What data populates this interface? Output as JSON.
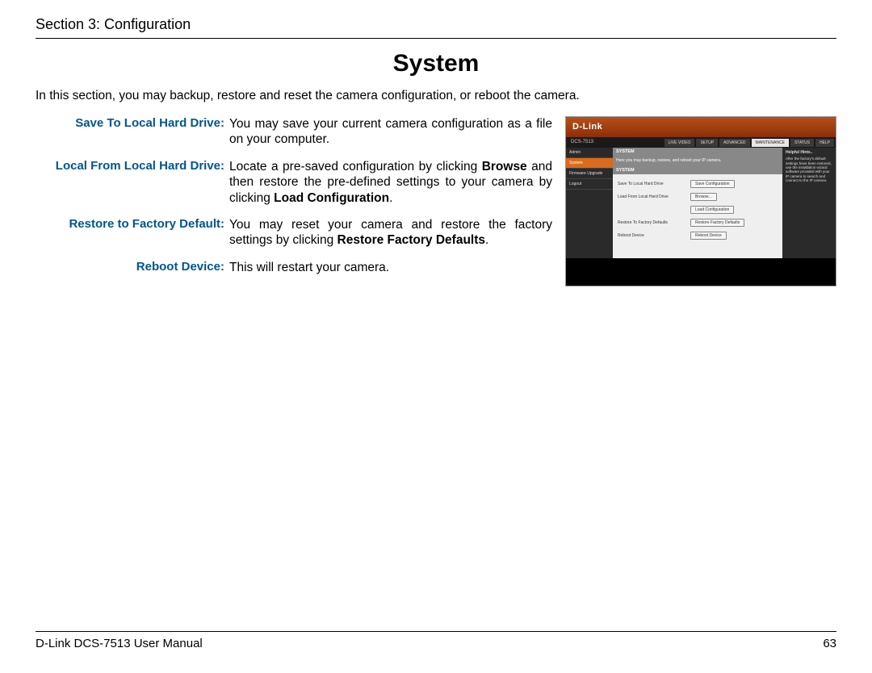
{
  "header": {
    "section": "Section 3: Configuration"
  },
  "title": "System",
  "intro": "In this section, you may backup, restore and reset the camera configuration, or reboot the camera.",
  "definitions": [
    {
      "label": "Save To Local Hard Drive:",
      "desc": "You may save your current camera configuration as a file on your computer."
    },
    {
      "label": "Local From Local Hard Drive:",
      "desc": "Locate a pre-saved configuration by clicking <b>Browse</b> and then restore the pre-defined settings to your camera by clicking <b>Load Configuration</b>."
    },
    {
      "label": "Restore to Factory Default:",
      "desc": "You may reset your camera and restore the factory settings by clicking <b>Restore Factory Defaults</b>."
    },
    {
      "label": "Reboot Device:",
      "desc": "This will restart your camera."
    }
  ],
  "screenshot": {
    "brand": "D-Link",
    "model": "DCS-7513",
    "tabs": [
      "LIVE VIDEO",
      "SETUP",
      "ADVANCED",
      "MAINTENANCE",
      "STATUS",
      "HELP"
    ],
    "active_tab": "MAINTENANCE",
    "side_items": [
      "Admin",
      "System",
      "Firmware Upgrade",
      "Logout"
    ],
    "side_active": "System",
    "panel_title": "SYSTEM",
    "panel_desc": "Here you may backup, restore, and reboot your IP camera.",
    "panel_section": "SYSTEM",
    "rows": [
      {
        "label": "Save To Local Hard Drive",
        "button": "Save Configuration"
      },
      {
        "label": "Load From Local Hard Drive",
        "button": "Browse..."
      },
      {
        "label": "",
        "button": "Load Configuration"
      },
      {
        "label": "Restore To Factory Defaults",
        "button": "Restore Factory Defaults"
      },
      {
        "label": "Reboot Device",
        "button": "Reboot Device"
      }
    ],
    "hints_title": "Helpful Hints..",
    "hints_body": "After the factory's default settings have been restored, use the installation wizard software provided with your IP camera to search and connect to the IP camera."
  },
  "footer": {
    "left": "D-Link DCS-7513 User Manual",
    "page": "63"
  }
}
